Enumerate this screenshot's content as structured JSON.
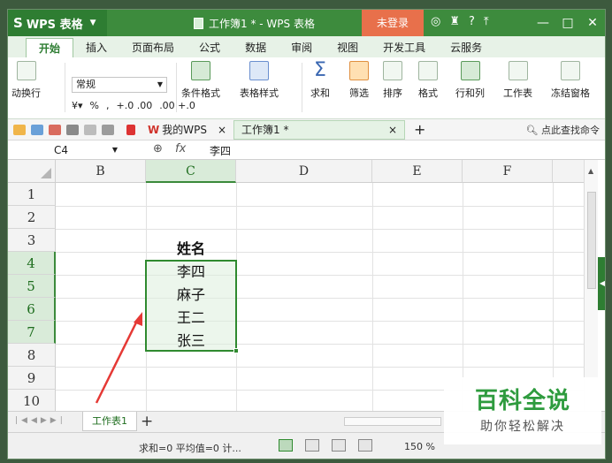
{
  "app": {
    "name": "WPS 表格",
    "title": "工作簿1 * - WPS 表格",
    "login_label": "未登录"
  },
  "ribbon_tabs": [
    "开始",
    "插入",
    "页面布局",
    "公式",
    "数据",
    "审阅",
    "视图",
    "开发工具",
    "云服务"
  ],
  "ribbon": {
    "wrap_label": "动换行",
    "number_format": "常规",
    "percent": "%",
    "comma": ",",
    "dec_inc": "+.0 .00",
    "dec_dec": ".00 +.0",
    "cond_format": "条件格式",
    "table_style": "表格样式",
    "sum": "求和",
    "filter": "筛选",
    "sort": "排序",
    "format": "格式",
    "rows_cols": "行和列",
    "worksheet": "工作表",
    "freeze": "冻结窗格"
  },
  "quickbar": {
    "wps_tab": "我的WPS",
    "book_tab": "工作簿1 *",
    "search": "点此查找命令"
  },
  "formula_bar": {
    "cell_ref": "C4",
    "fx": "fx",
    "value": "李四"
  },
  "grid": {
    "columns": [
      "B",
      "C",
      "D",
      "E",
      "F"
    ],
    "rows": [
      "1",
      "2",
      "3",
      "4",
      "5",
      "6",
      "7",
      "8",
      "9",
      "10"
    ],
    "header_cell": "姓名",
    "names": [
      "李四",
      "麻子",
      "王二",
      "张三"
    ]
  },
  "sheet": {
    "tab": "工作表1"
  },
  "status": {
    "text": "求和=0 平均值=0 计...",
    "zoom": "150 %"
  },
  "watermark": {
    "line1": "百科全说",
    "line2": "助你轻松解决"
  },
  "colors": {
    "accent": "#2f8a2f",
    "title_bar": "#3d8b3d",
    "login": "#e8704b"
  }
}
